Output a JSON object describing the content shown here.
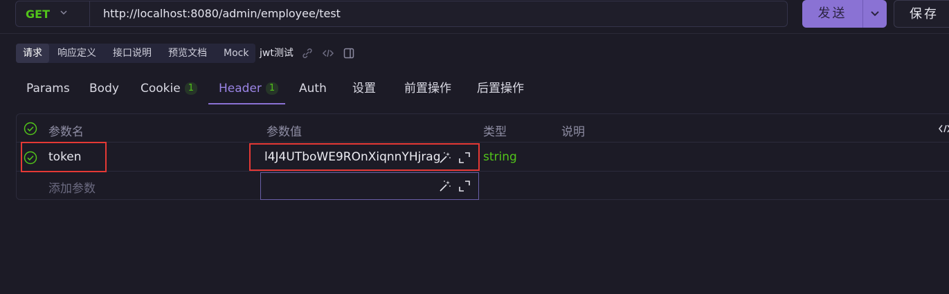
{
  "request": {
    "method": "GET",
    "url": "http://localhost:8080/admin/employee/test",
    "send_label": "发送",
    "save_label": "保存"
  },
  "subtabs": {
    "items": [
      "请求",
      "响应定义",
      "接口说明",
      "预览文档",
      "Mock"
    ],
    "name": "jwt测试"
  },
  "tabs": [
    {
      "label": "Params"
    },
    {
      "label": "Body"
    },
    {
      "label": "Cookie",
      "count": "1"
    },
    {
      "label": "Header",
      "count": "1",
      "active": true
    },
    {
      "label": "Auth"
    },
    {
      "label": "设置"
    },
    {
      "label": "前置操作"
    },
    {
      "label": "后置操作"
    }
  ],
  "table": {
    "headers": {
      "name": "参数名",
      "value": "参数值",
      "type": "类型",
      "description": "说明"
    },
    "rows": [
      {
        "name": "token",
        "value": "l4J4UTboWE9ROnXiqnnYHjrag",
        "type": "string",
        "enabled": true
      }
    ],
    "add_placeholder": "添加参数"
  },
  "colors": {
    "accent": "#8a72d4",
    "method": "#52c41a",
    "type": "#52c41a",
    "highlight": "#e53935"
  }
}
